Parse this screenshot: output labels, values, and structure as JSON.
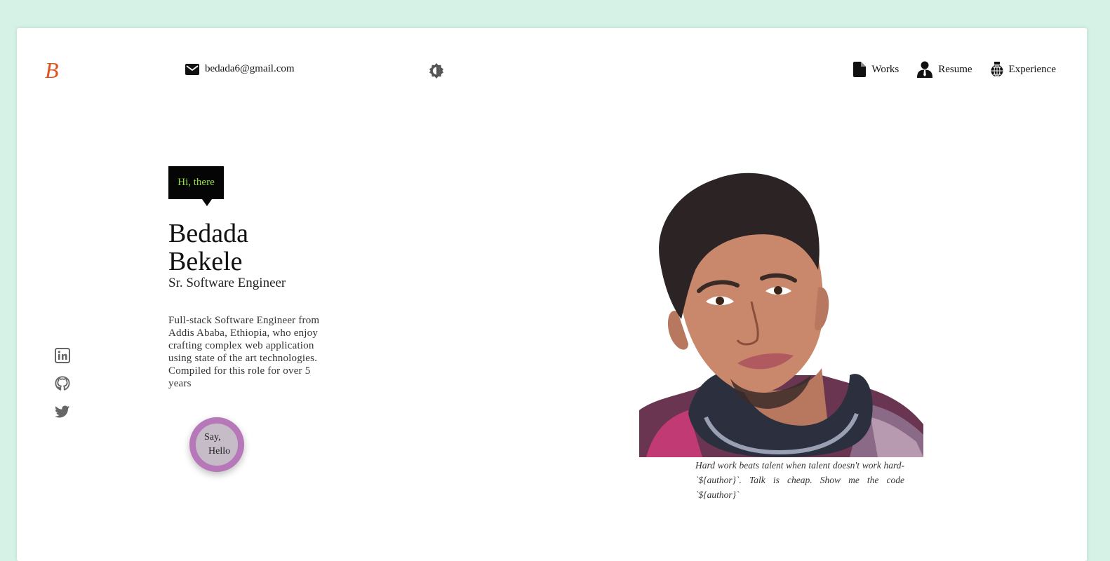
{
  "header": {
    "logo_text": "B",
    "email": "bedada6@gmail.com",
    "theme_toggle_icon": "brightness-icon",
    "nav": [
      {
        "label": "Works",
        "icon": "document-icon"
      },
      {
        "label": "Resume",
        "icon": "person-icon"
      },
      {
        "label": "Experience",
        "icon": "globe-icon"
      }
    ]
  },
  "social": [
    {
      "name": "linkedin",
      "icon": "linkedin-icon"
    },
    {
      "name": "github",
      "icon": "github-icon"
    },
    {
      "name": "twitter",
      "icon": "twitter-icon"
    }
  ],
  "intro": {
    "greeting": "Hi, there",
    "first_name": "Bedada",
    "last_name": "Bekele",
    "role": "Sr. Software Engineer",
    "bio": "Full-stack Software Engineer from Addis Ababa, Ethiopia, who enjoy crafting complex web application using state of the art technologies. Compiled for this role for over 5 years",
    "cta_line1": "Say,",
    "cta_line2": "Hello"
  },
  "quote": "Hard work beats talent when talent doesn't work hard- `${author}`. Talk is cheap. Show me the code `${author}`",
  "colors": {
    "page_bg": "#d6f2e6",
    "card_bg": "#ffffff",
    "greeting_bg": "#050505",
    "greeting_text": "#8ee03a",
    "cta_ring": "#b778b9",
    "cta_fill": "#c6bcc7",
    "logo": "#e0531f"
  }
}
